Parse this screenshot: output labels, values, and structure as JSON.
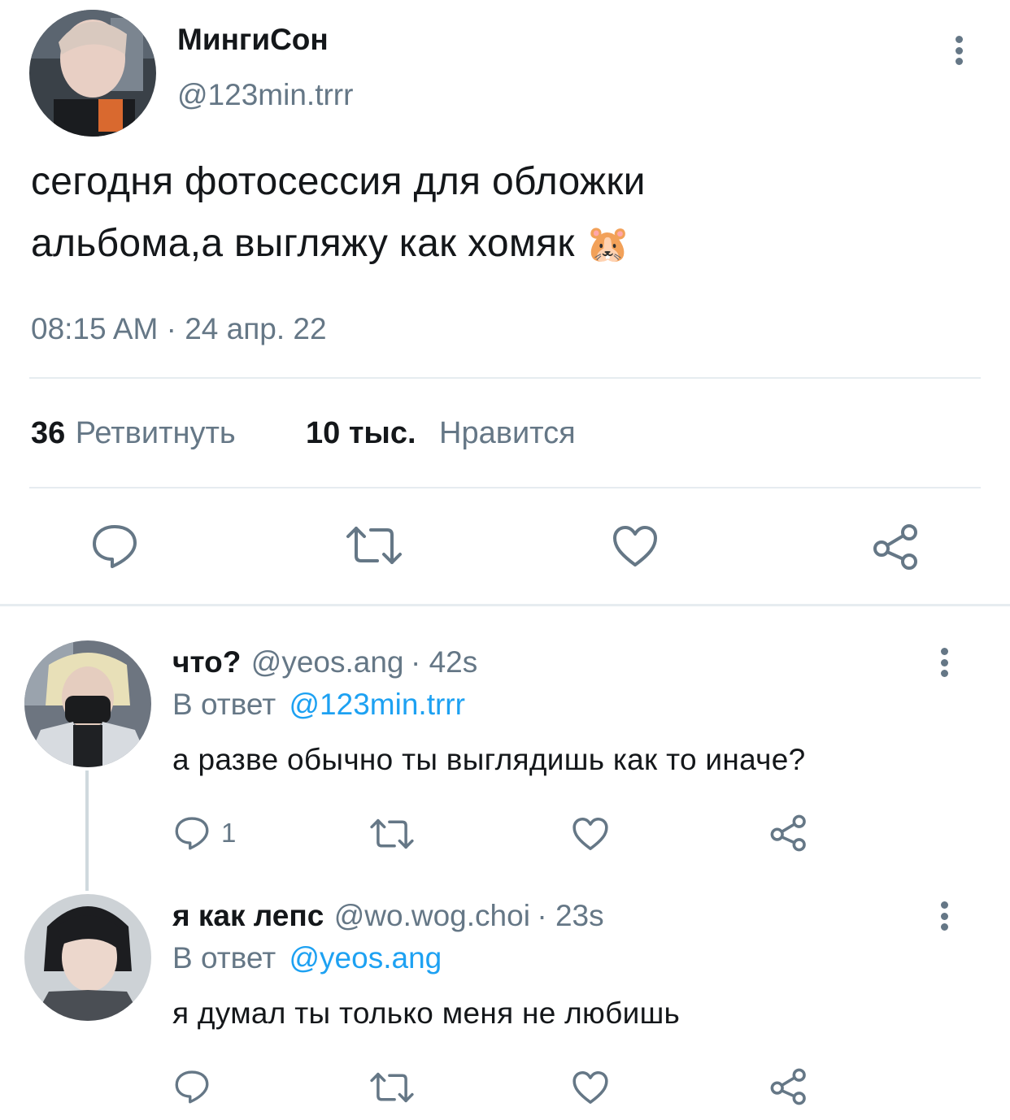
{
  "tweet": {
    "author_name": "МингиСон",
    "author_handle": "@123min.trrr",
    "text_line1": "сегодня фотосессия для обложки",
    "text_line2": "альбома,а выгляжу как хомяк",
    "emoji": "🐹",
    "timestamp": "08:15 AM · 24 апр. 22",
    "retweets_count": "36",
    "retweets_label": "Ретвитнуть",
    "likes_count": "10 тыс.",
    "likes_label": "Нравится"
  },
  "replies": [
    {
      "name": "что?",
      "handle": "@yeos.ang",
      "age": "· 42s",
      "reply_prefix": "В ответ",
      "reply_to": "@123min.trrr",
      "text": "а разве обычно ты выглядишь как то иначе?",
      "reply_count": "1"
    },
    {
      "name": "я как лепс",
      "handle": "@wo.wog.choi",
      "age": "· 23s",
      "reply_prefix": "В ответ",
      "reply_to": "@yeos.ang",
      "text": "я думал ты только меня не любишь",
      "reply_count": ""
    }
  ],
  "icons": {
    "reply": "speech-bubble-icon",
    "retweet": "retweet-icon",
    "like": "heart-icon",
    "share": "share-icon",
    "more": "vertical-dots-icon"
  },
  "colors": {
    "text": "#14171a",
    "secondary": "#657786",
    "link": "#1da1f2",
    "divider": "#e6ecf0"
  }
}
